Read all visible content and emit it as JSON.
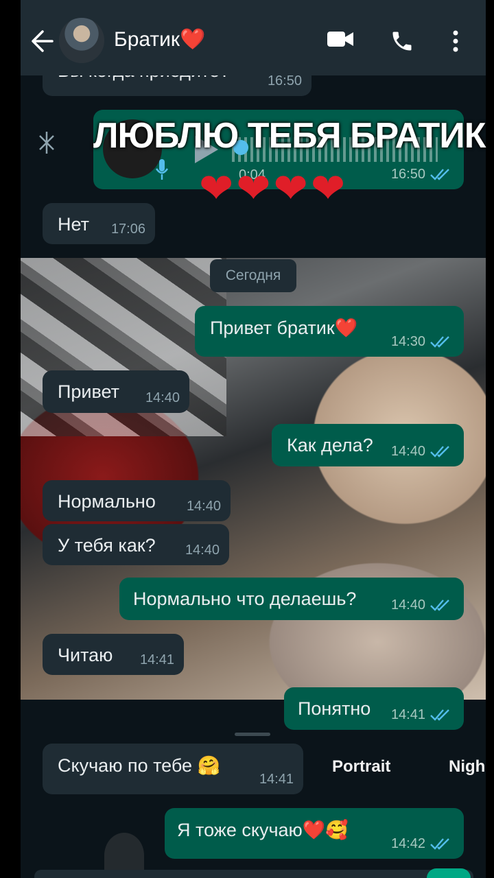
{
  "header": {
    "contact_name": "Братик",
    "contact_emoji": "❤️",
    "icons": [
      "back-arrow-icon",
      "video-call-icon",
      "voice-call-icon",
      "more-options-icon"
    ]
  },
  "overlay": {
    "caption": "ЛЮБЛЮ ТЕБЯ БРАТИК",
    "hearts": "❤❤❤❤"
  },
  "messages": [
    {
      "dir": "in",
      "text": "Вы когда приедите?",
      "time": "16:50"
    },
    {
      "dir": "out",
      "kind": "voice",
      "duration": "0:04",
      "time": "16:50",
      "read": true
    },
    {
      "dir": "in",
      "text": "Нет",
      "time": "17:06"
    },
    {
      "dir": "out",
      "text": "Привет братик❤️",
      "time": "14:30",
      "read": true
    },
    {
      "dir": "in",
      "text": "Привет",
      "time": "14:40"
    },
    {
      "dir": "out",
      "text": "Как дела?",
      "time": "14:40",
      "read": true
    },
    {
      "dir": "in",
      "text": "Нормально",
      "time": "14:40"
    },
    {
      "dir": "in",
      "text": "У тебя как?",
      "time": "14:40"
    },
    {
      "dir": "out",
      "text": "Нормально что делаешь?",
      "time": "14:40",
      "read": true
    },
    {
      "dir": "in",
      "text": "Читаю",
      "time": "14:41"
    },
    {
      "dir": "out",
      "text": "Понятно",
      "time": "14:41",
      "read": true
    },
    {
      "dir": "in",
      "text": "Скучаю по тебе 🤗",
      "time": "14:41"
    },
    {
      "dir": "out",
      "text": "Я тоже скучаю❤️🥰",
      "time": "14:42",
      "read": true
    }
  ],
  "date_chip": "Сегодня",
  "camera_modes": {
    "portrait": "Portrait",
    "night": "Nigh"
  },
  "colors": {
    "incoming": "#1f2c34",
    "outgoing": "#005c4b",
    "read_ticks": "#53bdeb",
    "background": "#0b141a"
  }
}
